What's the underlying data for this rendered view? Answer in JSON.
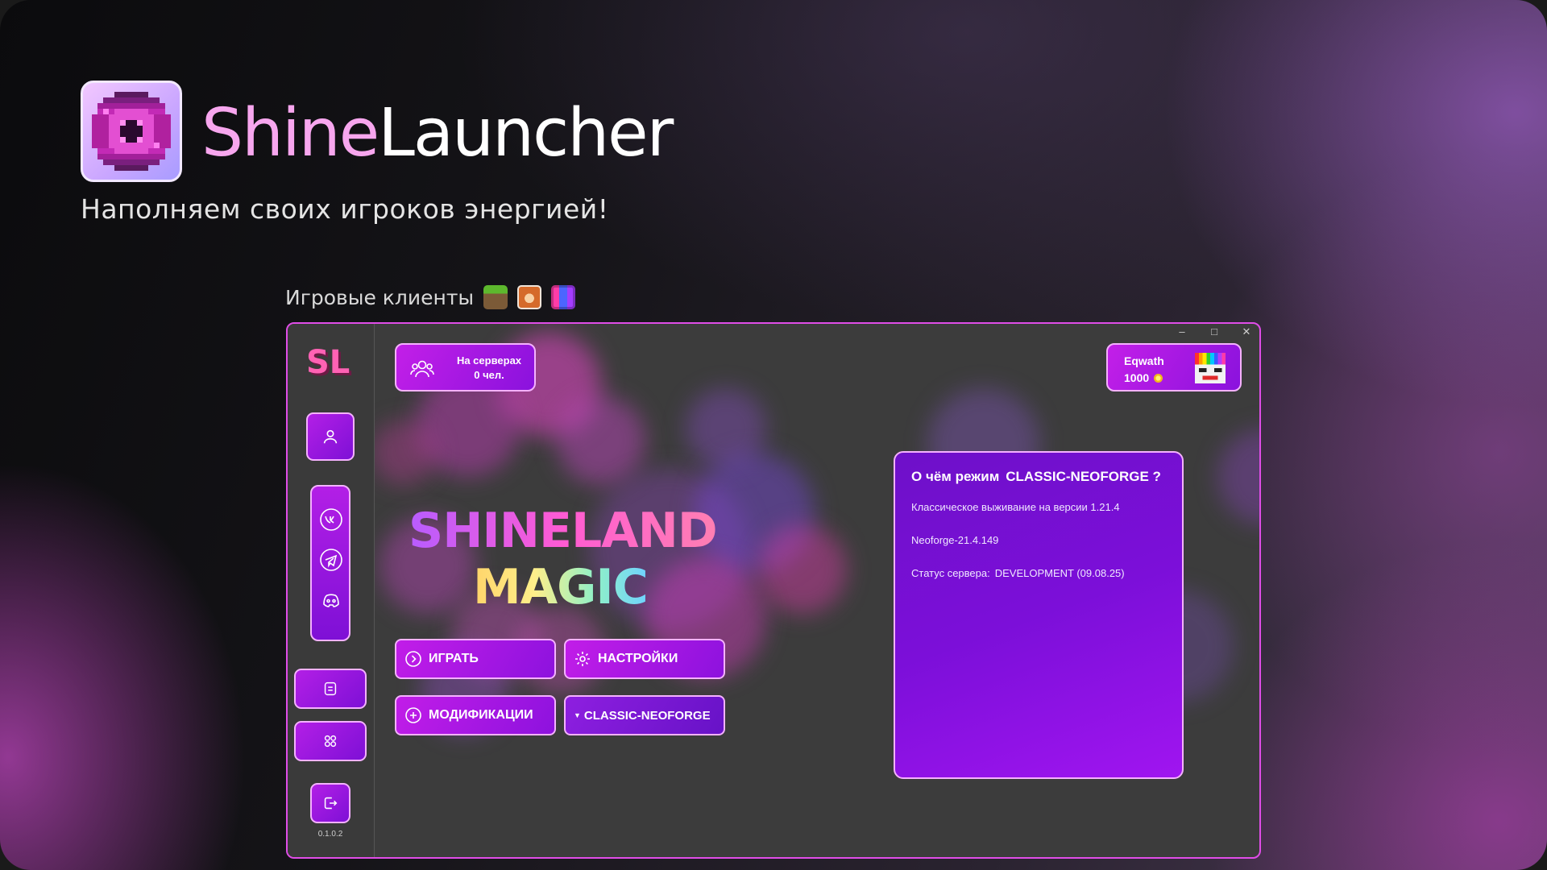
{
  "brand": {
    "part1": "Shine",
    "part2": "Launcher"
  },
  "tagline": "Наполняем своих игроков энергией!",
  "clients_label": "Игровые клиенты",
  "clients_icons": [
    "grass-block-icon",
    "fox-icon",
    "pixel-grid-icon"
  ],
  "launcher": {
    "version": "0.1.0.2",
    "online": {
      "label": "На серверах",
      "count": "0 чел."
    },
    "profile": {
      "name": "Eqwath",
      "balance": "1000"
    },
    "window_controls": [
      "–",
      "□",
      "✕"
    ],
    "title_line1": "SHINELAND",
    "title_line2": "MAGIC",
    "buttons": {
      "play": "ИГРАТЬ",
      "settings": "НАСТРОЙКИ",
      "mods": "МОДИФИКАЦИИ",
      "mode": "CLASSIC-NEOFORGE"
    },
    "info": {
      "heading_prefix": "О чём режим",
      "heading_mode": "CLASSIC-NEOFORGE ?",
      "line1": "Классическое выживание на версии 1.21.4",
      "line2": "Neoforge-21.4.149",
      "status_label": "Статус сервера:",
      "status_value": "DEVELOPMENT (09.08.25)"
    }
  },
  "colors": {
    "accent": "#b31fe6",
    "accent_border": "#f5b1ff",
    "window_border": "#e04de8",
    "brand_pink": "#f7a6ee"
  }
}
